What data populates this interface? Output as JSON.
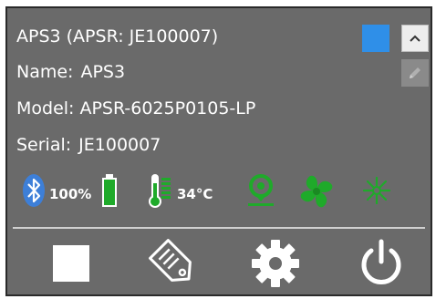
{
  "device": {
    "title": "APS3 (APSR: JE100007)",
    "name_label": "Name:",
    "name_value": "APS3",
    "model_label": "Model:",
    "model_value": "APSR-6025P0105-LP",
    "serial_label": "Serial:",
    "serial_value": "JE100007",
    "color": "#2f8fe8"
  },
  "status": {
    "battery_percent": "100%",
    "battery_level": 1.0,
    "temperature": "34°C",
    "icons": [
      "bluetooth-icon",
      "battery-icon",
      "thermometer-icon",
      "location-pin-icon",
      "fan-icon",
      "light-icon"
    ],
    "accent_color": "#1faa2a"
  },
  "actions": [
    "stop-button",
    "tag-button",
    "settings-button",
    "power-button"
  ]
}
